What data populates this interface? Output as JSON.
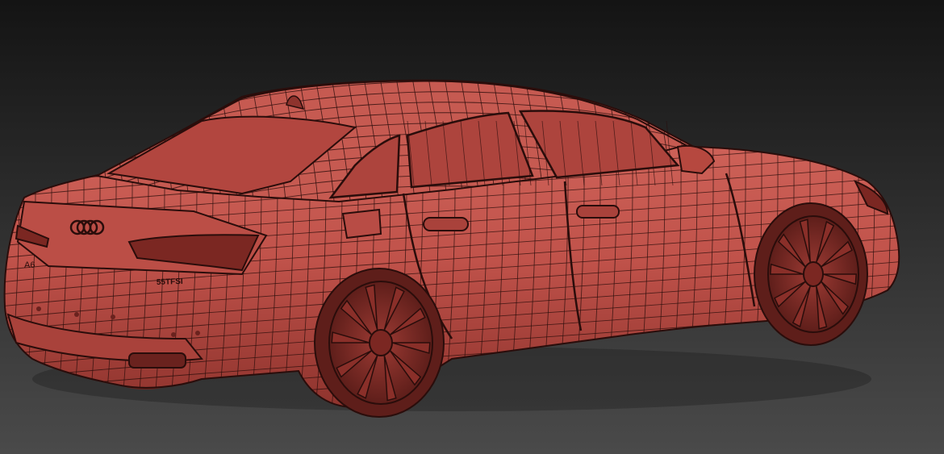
{
  "scene": {
    "background_top": "#141414",
    "background_bottom": "#4a4a4a",
    "body_color": "#c0524a",
    "body_shade": "#8e332d",
    "body_light": "#d56a60",
    "wire_color": "#2a0d0b",
    "badge_text": "55TFSI",
    "model_badge": "A6"
  }
}
